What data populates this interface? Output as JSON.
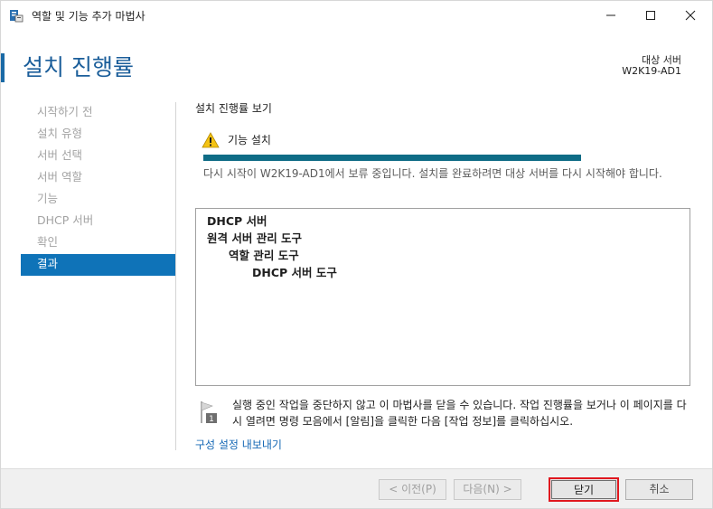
{
  "window": {
    "title": "역할 및 기능 추가 마법사"
  },
  "header": {
    "page_title": "설치 진행률",
    "target_label": "대상 서버",
    "target_name": "W2K19-AD1"
  },
  "nav": {
    "items": [
      {
        "label": "시작하기 전"
      },
      {
        "label": "설치 유형"
      },
      {
        "label": "서버 선택"
      },
      {
        "label": "서버 역할"
      },
      {
        "label": "기능"
      },
      {
        "label": "DHCP 서버"
      },
      {
        "label": "확인"
      },
      {
        "label": "결과",
        "active": true
      }
    ]
  },
  "content": {
    "section_title": "설치 진행률 보기",
    "feature_label": "기능 설치",
    "progress": 1.0,
    "status_text": "다시 시작이 W2K19-AD1에서 보류 중입니다. 설치를 완료하려면 대상 서버를 다시 시작해야 합니다.",
    "results": [
      {
        "text": "DHCP 서버",
        "level": 0
      },
      {
        "text": "원격 서버 관리 도구",
        "level": 0
      },
      {
        "text": "역할 관리 도구",
        "level": 1
      },
      {
        "text": "DHCP 서버 도구",
        "level": 2
      }
    ],
    "info_text": "실행 중인 작업을 중단하지 않고 이 마법사를 닫을 수 있습니다. 작업 진행률을 보거나 이 페이지를 다시 열려면 명령 모음에서 [알림]을 클릭한 다음 [작업 정보]를 클릭하십시오.",
    "flag_badge": "1",
    "export_link": "구성 설정 내보내기"
  },
  "footer": {
    "prev_label": "< 이전(P)",
    "next_label": "다음(N) >",
    "close_label": "닫기",
    "cancel_label": "취소"
  },
  "colors": {
    "accent": "#0f73b8",
    "progress": "#0f6c86",
    "title": "#1b5e9a",
    "link": "#1668b5",
    "highlight": "#e0181f"
  }
}
